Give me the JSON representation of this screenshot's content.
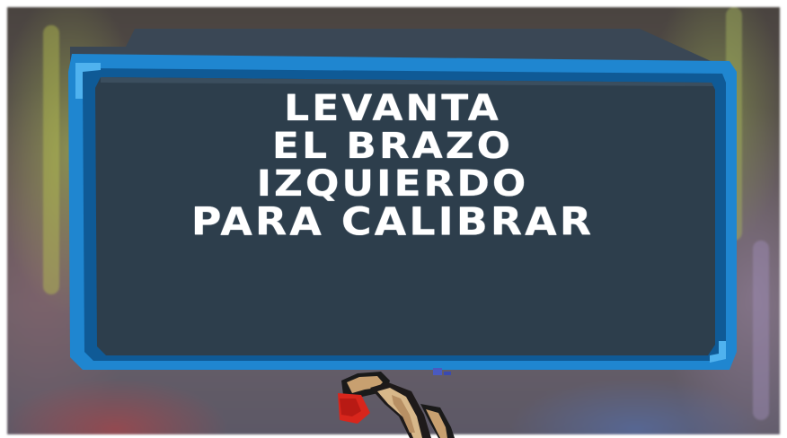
{
  "dialog": {
    "lines": [
      "Levanta",
      "el brazo",
      "izquierdo",
      "para calibrar"
    ]
  },
  "colors": {
    "panel_fill": "#2d3e4c",
    "panel_border": "#1f86d0",
    "panel_border_dark": "#0f5a96",
    "panel_top": "#3a4a58",
    "text": "#ffffff"
  },
  "icons": {
    "character": "player-character-sprite"
  }
}
